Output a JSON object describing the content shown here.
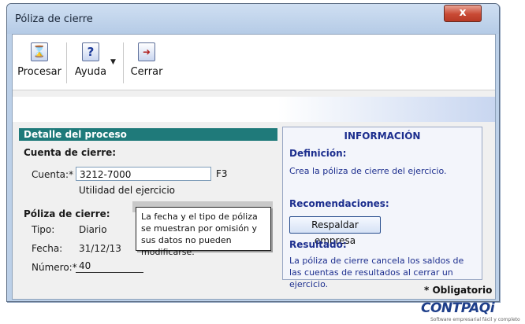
{
  "window": {
    "title": "Póliza de cierre",
    "close_symbol": "x"
  },
  "toolbar": {
    "procesar_label": "Procesar",
    "ayuda_label": "Ayuda",
    "ayuda_caret": "▼",
    "cerrar_label": "Cerrar",
    "procesar_icon_glyph": "⌛",
    "ayuda_icon_glyph": "?",
    "cerrar_icon_glyph": "➜"
  },
  "detalle": {
    "header": "Detalle del proceso",
    "cuenta_section": "Cuenta de cierre:",
    "cuenta_label": "Cuenta:*",
    "cuenta_value": "3212-7000",
    "cuenta_shortcut": "F3",
    "cuenta_desc": "Utilidad del ejercicio",
    "poliza_section": "Póliza de cierre:",
    "tipo_label": "Tipo:",
    "tipo_value": "Diario",
    "fecha_label": "Fecha:",
    "fecha_value": "31/12/13",
    "numero_label": "Número:*",
    "numero_value": "40"
  },
  "tooltip": {
    "text": "La fecha y el tipo de póliza se muestran por omisión y sus datos no pueden modificarse."
  },
  "info": {
    "title": "INFORMACIÓN",
    "definicion_label": "Definición:",
    "definicion_text": "Crea la póliza de cierre del ejercicio.",
    "recomendaciones_label": "Recomendaciones:",
    "respaldar_button": "Respaldar empresa",
    "resultado_label": "Resultado:",
    "resultado_text": "La póliza de cierre cancela los saldos de las cuentas de resultados al cerrar un ejercicio."
  },
  "footer": {
    "obligatorio": "* Obligatorio"
  },
  "brand": {
    "logo_text": "CONTPAQi",
    "tagline": "Software empresarial fácil y completo"
  }
}
